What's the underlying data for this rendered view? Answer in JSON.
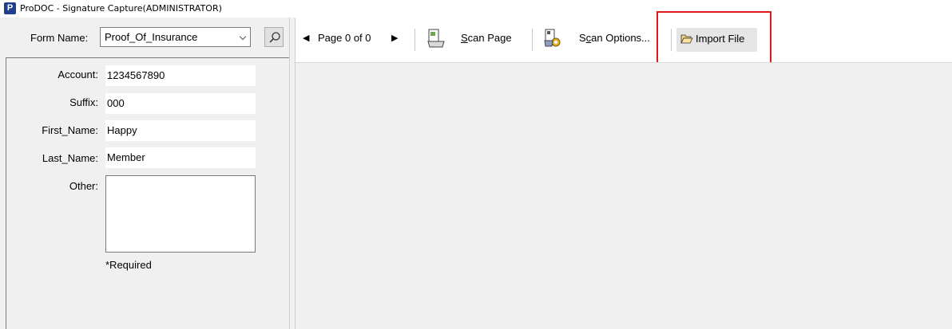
{
  "window": {
    "title": "ProDOC - Signature Capture(ADMINISTRATOR)",
    "logo_letter": "P"
  },
  "form_selector": {
    "label": "Form Name:",
    "value": "Proof_Of_Insurance"
  },
  "fields": [
    {
      "label": "Account:",
      "value": "1234567890"
    },
    {
      "label": "Suffix:",
      "value": "000"
    },
    {
      "label": "First_Name:",
      "value": "Happy"
    },
    {
      "label": "Last_Name:",
      "value": "Member"
    },
    {
      "label": "Other:",
      "value": ""
    }
  ],
  "required_note": "*Required",
  "toolbar": {
    "page_text": "Page 0 of 0",
    "scan_page_pre": "",
    "scan_page_ul": "S",
    "scan_page_post": "can Page",
    "scan_options_pre": "S",
    "scan_options_ul": "c",
    "scan_options_post": "an Options...",
    "import_file_label": "Import File"
  },
  "colors": {
    "highlight": "#e0191b",
    "panel": "#f0f0f0"
  }
}
